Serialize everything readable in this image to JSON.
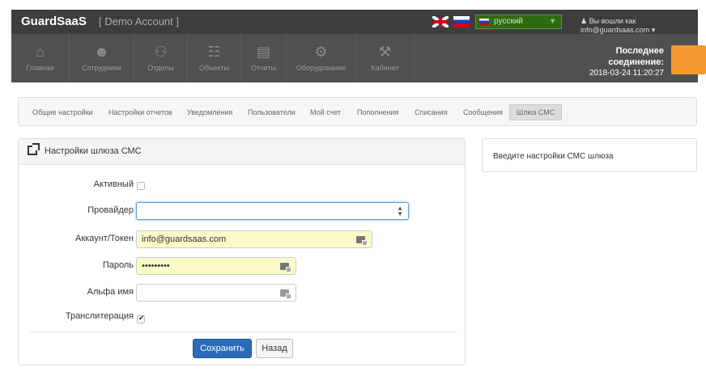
{
  "header": {
    "brand": "GuardSaaS",
    "account": "[ Demo Account ]",
    "language": "русский",
    "user_text": "Вы вошли как info@guardsaas.com"
  },
  "nav": {
    "items": [
      {
        "label": "Главная",
        "icon": "home-icon",
        "glyph": "⌂"
      },
      {
        "label": "Сотрудники",
        "icon": "user-icon",
        "glyph": "☺"
      },
      {
        "label": "Отделы",
        "icon": "group-icon",
        "glyph": "⚇"
      },
      {
        "label": "Объекты",
        "icon": "sitemap-icon",
        "glyph": "☷"
      },
      {
        "label": "Отчеты",
        "icon": "chart-icon",
        "glyph": "▓"
      },
      {
        "label": "Оборудование",
        "icon": "gears-icon",
        "glyph": "⚙"
      },
      {
        "label": "Кабинет",
        "icon": "wrench-icon",
        "glyph": "⚒"
      }
    ],
    "connection_title": "Последнее соединение:",
    "connection_time": "2018-03-24 11:20:27",
    "accent_color": "#f49a2e"
  },
  "tabs": [
    "Общие настройки",
    "Настройки отчетов",
    "Уведомления",
    "Пользователи",
    "Мой счет",
    "Пополнения",
    "Списания",
    "Сообщения",
    "Шлюз СМС"
  ],
  "active_tab": "Шлюз СМС",
  "form": {
    "title": "Настройки шлюза СМС",
    "active_label": "Активный",
    "active_checked": false,
    "provider_label": "Провайдер",
    "provider_value": "",
    "account_label": "Аккаунт/Токен",
    "account_value": "info@guardsaas.com",
    "password_label": "Пароль",
    "password_value": "•••••••••",
    "alpha_label": "Альфа имя",
    "alpha_value": "",
    "translit_label": "Транслитерация",
    "translit_checked": true,
    "save_label": "Сохранить",
    "back_label": "Назад"
  },
  "info": {
    "text": "Введите настройки СМС шлюза"
  }
}
